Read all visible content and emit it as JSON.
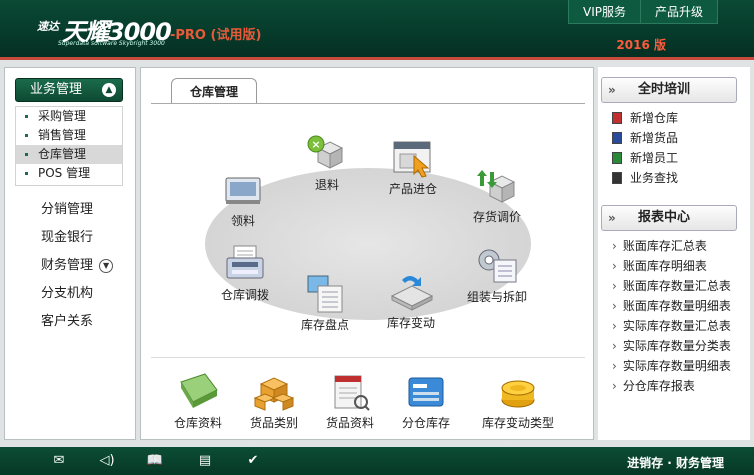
{
  "header": {
    "logo_small": "速达",
    "logo_big": "天耀3000",
    "logo_sub": "Superdata software Skybright 3000",
    "logo_pro": "-PRO (试用版)",
    "buttons": [
      "VIP服务",
      "产品升级"
    ],
    "year": "2016 版"
  },
  "sidebar": {
    "section_title": "业务管理",
    "sub_items": [
      {
        "label": "采购管理"
      },
      {
        "label": "销售管理"
      },
      {
        "label": "仓库管理",
        "active": true
      },
      {
        "label": "POS 管理"
      }
    ],
    "items": [
      {
        "label": "分销管理"
      },
      {
        "label": "现金银行"
      },
      {
        "label": "财务管理"
      },
      {
        "label": "分支机构"
      },
      {
        "label": "客户关系"
      }
    ]
  },
  "main": {
    "tab": "仓库管理",
    "flow": [
      "退料",
      "产品进仓",
      "领料",
      "存货调价",
      "仓库调拨",
      "组装与拆卸",
      "库存盘点",
      "库存变动"
    ],
    "bottom": [
      "仓库资料",
      "货品类别",
      "货品资料",
      "分仓库存",
      "库存变动类型"
    ]
  },
  "right": {
    "training_title": "全时培训",
    "training_items": [
      "新增仓库",
      "新增货品",
      "新增员工",
      "业务查找"
    ],
    "report_title": "报表中心",
    "report_items": [
      "账面库存汇总表",
      "账面库存明细表",
      "账面库存数量汇总表",
      "账面库存数量明细表",
      "实际库存数量汇总表",
      "实际库存数量分类表",
      "实际库存数量明细表",
      "分仓库存报表"
    ]
  },
  "footer": {
    "text": "进销存 · 财务管理",
    "icons": [
      "mail-icon",
      "speaker-icon",
      "book-icon",
      "document-icon",
      "check-circle-icon"
    ]
  },
  "colors": {
    "brand_green": "#0a4a35",
    "accent_red": "#c84a3a"
  }
}
